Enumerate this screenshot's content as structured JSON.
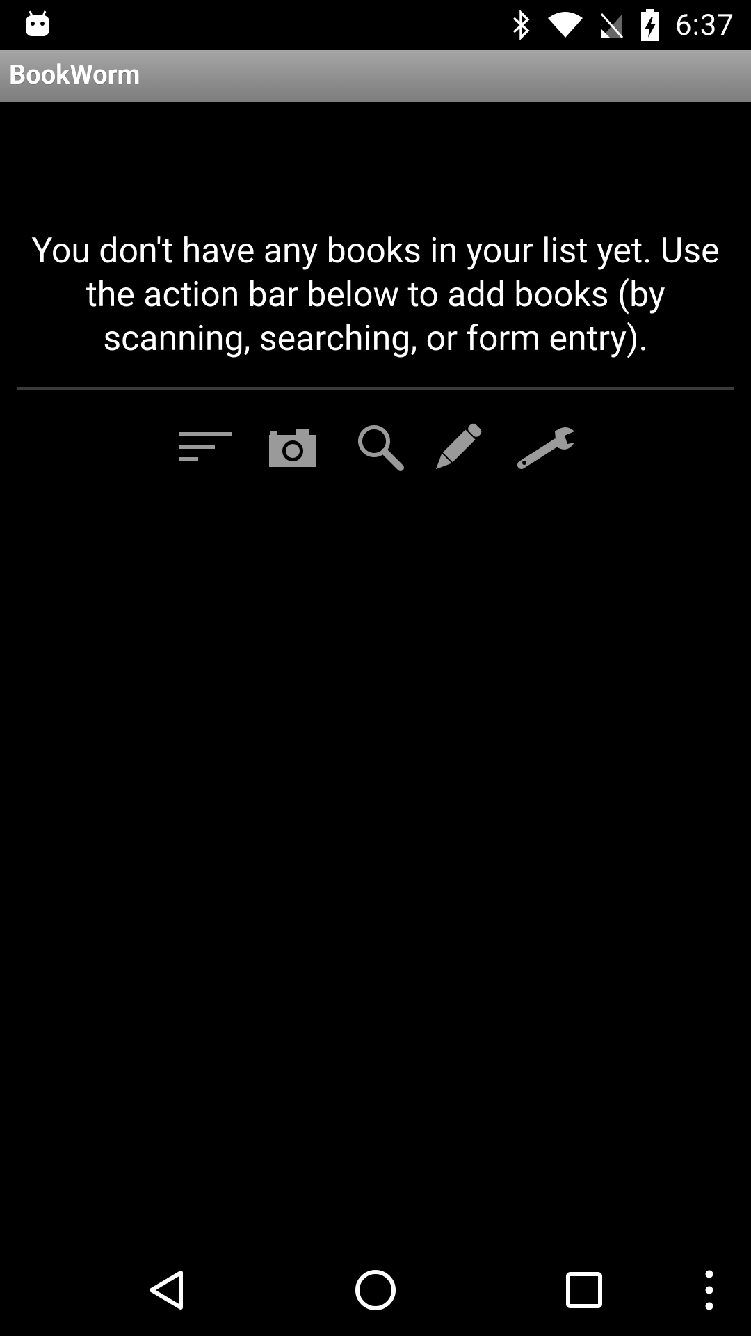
{
  "status_bar": {
    "time": "6:37",
    "icons": [
      "android-notification-icon",
      "bluetooth-icon",
      "wifi-icon",
      "no-sim-icon",
      "battery-charging-icon"
    ]
  },
  "app": {
    "title": "BookWorm"
  },
  "main": {
    "empty_message": "You don't have any books in your list yet. Use the action bar below to add books (by scanning, searching, or form entry)."
  },
  "action_bar": {
    "items": [
      "sort-icon",
      "camera-icon",
      "search-icon",
      "pencil-icon",
      "wrench-icon"
    ]
  },
  "nav_bar": {
    "items": [
      "back-icon",
      "home-icon",
      "recents-icon",
      "overflow-menu-icon"
    ]
  },
  "colors": {
    "background": "#000000",
    "title_bar": "#8f8f8f",
    "icon_gray": "#9a9a9a",
    "divider": "#3b3b3b"
  }
}
